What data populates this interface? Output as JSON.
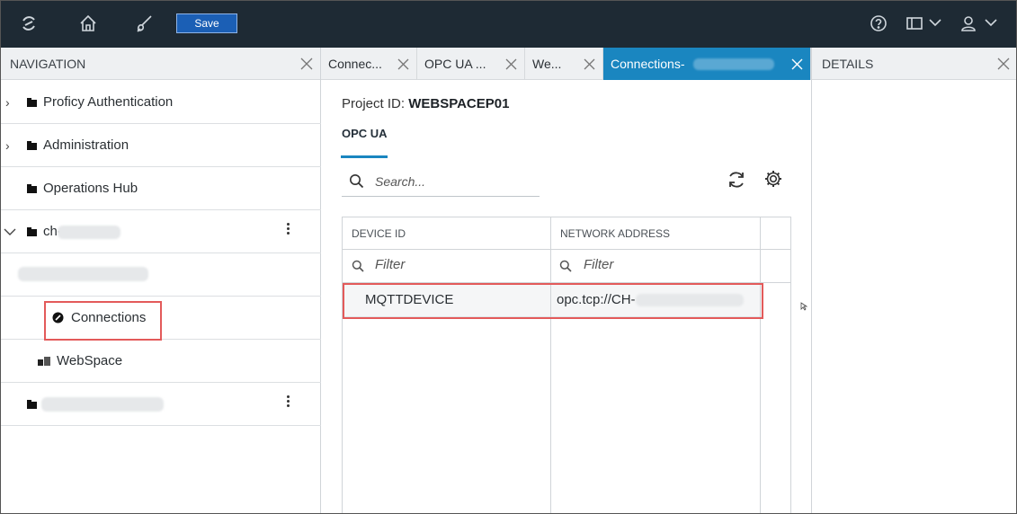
{
  "topbar": {
    "save_label": "Save",
    "icons": [
      "app-logo-icon",
      "home-icon",
      "brush-icon",
      "help-icon",
      "layout-icon",
      "user-icon"
    ]
  },
  "navigation": {
    "title": "NAVIGATION",
    "items": [
      {
        "label": "Proficy Authentication"
      },
      {
        "label": "Administration"
      },
      {
        "label": "Operations Hub"
      },
      {
        "label": "ch-"
      },
      {
        "label": "Connections"
      },
      {
        "label": "WebSpace"
      }
    ]
  },
  "tabs": [
    {
      "label": "Connec..."
    },
    {
      "label": "OPC UA ..."
    },
    {
      "label": "We..."
    },
    {
      "label": "Connections-"
    }
  ],
  "main": {
    "project_label": "Project ID:",
    "project_id": "WEBSPACEP01",
    "subtab": "OPC UA",
    "search_placeholder": "Search...",
    "columns": [
      "DEVICE ID",
      "NETWORK ADDRESS"
    ],
    "filter_placeholder": "Filter",
    "rows": [
      {
        "device_id": "MQTTDEVICE",
        "network_address": "opc.tcp://CH-"
      }
    ]
  },
  "details": {
    "title": "DETAILS"
  },
  "colors": {
    "topbar": "#1e2a34",
    "accent": "#1a86c0",
    "save_button": "#1b5fb5",
    "highlight": "#e35a5a"
  }
}
